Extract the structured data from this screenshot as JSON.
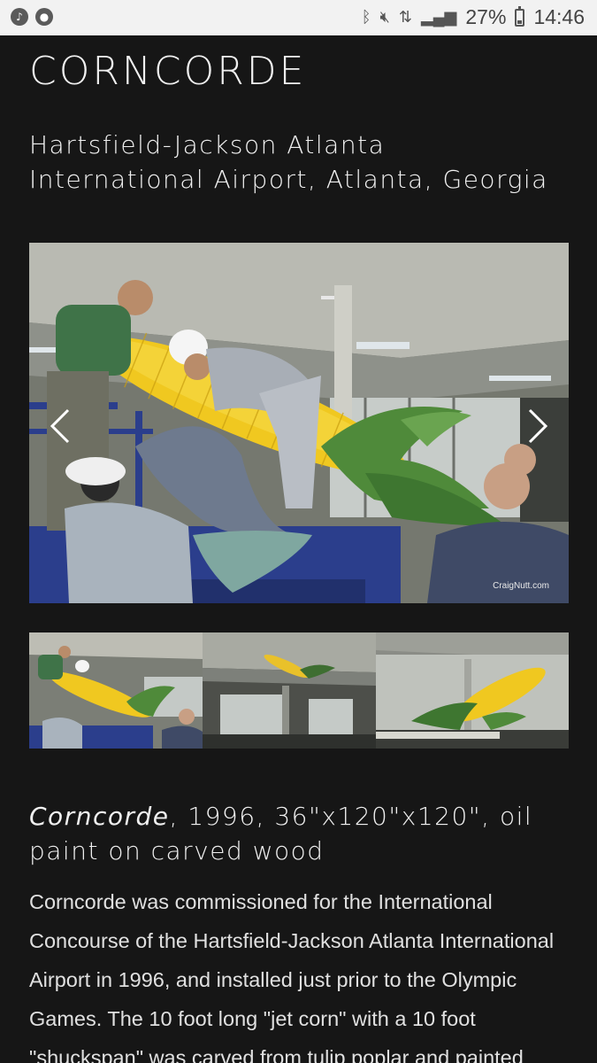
{
  "status_bar": {
    "battery": "27%",
    "time": "14:46",
    "left_icons": [
      "music-icon",
      "app-icon"
    ],
    "right_icons": [
      "bluetooth-icon",
      "mute-icon",
      "data-icon",
      "signal-icon",
      "battery-icon"
    ]
  },
  "page": {
    "title": "CORNCORDE",
    "location": "Hartsfield-Jackson Atlanta International Airport, Atlanta, Georgia"
  },
  "gallery": {
    "main_watermark": "CraigNutt.com",
    "thumbnail_count": 3
  },
  "caption": {
    "title_italic": "Corncorde",
    "details": ", 1996, 36\"x120\"x120\", oil paint on carved wood"
  },
  "description": "Corncorde was commissioned for the International Concourse of the Hartsfield-Jackson Atlanta International Airport in 1996, and installed just prior to the Olympic Games.  The 10 foot long \"jet corn\" with a 10 foot \"shuckspan\" was carved from tulip poplar and painted",
  "colors": {
    "background": "#161616",
    "corn_yellow": "#f0c820",
    "husk_green": "#4f8a3a"
  }
}
